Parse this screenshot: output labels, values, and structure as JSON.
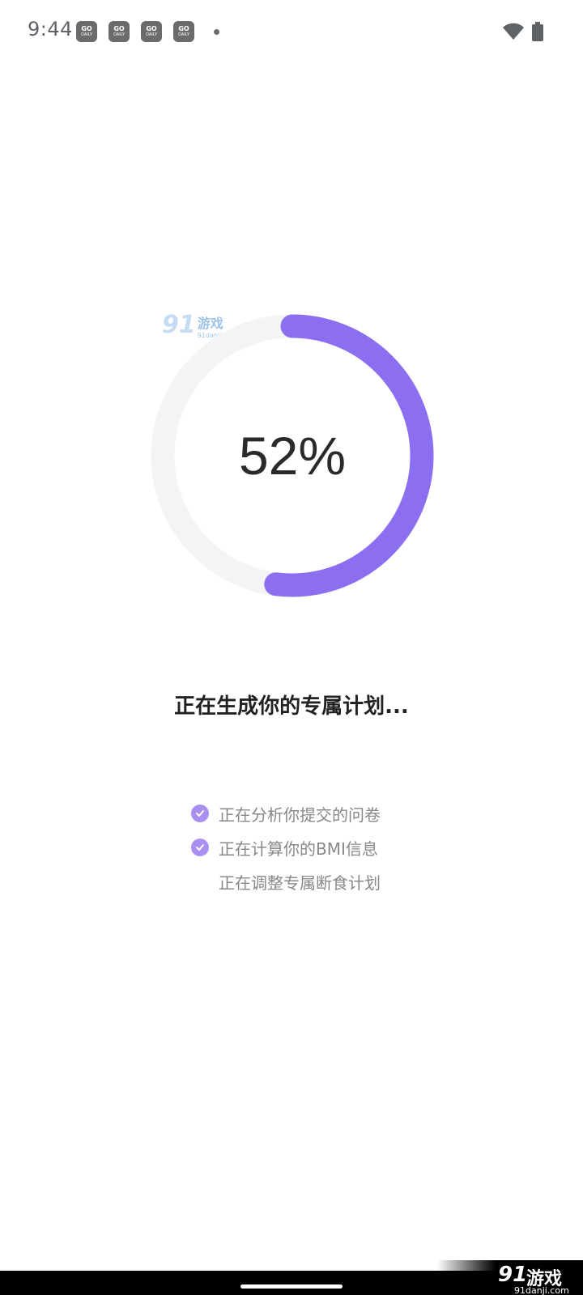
{
  "status_bar": {
    "time": "9:44",
    "notifications": [
      {
        "top": "GO",
        "bottom": "DAILY"
      },
      {
        "top": "GO",
        "bottom": "DAILY"
      },
      {
        "top": "GO",
        "bottom": "DAILY"
      },
      {
        "top": "GO",
        "bottom": "DAILY"
      }
    ],
    "icons": [
      "wifi-icon",
      "battery-icon"
    ]
  },
  "progress": {
    "value": 52,
    "label": "52%",
    "track_color": "#f3f4f5",
    "fill_color": "#8c6ff1"
  },
  "watermark": {
    "number": "91",
    "name": "游戏",
    "url": "91danji.com"
  },
  "headline": "正在生成你的专属计划...",
  "steps": [
    {
      "label": "正在分析你提交的问卷",
      "done": true
    },
    {
      "label": "正在计算你的BMI信息",
      "done": true
    },
    {
      "label": "正在调整专属断食计划",
      "done": false
    }
  ],
  "accent_color": "#a98ff0"
}
